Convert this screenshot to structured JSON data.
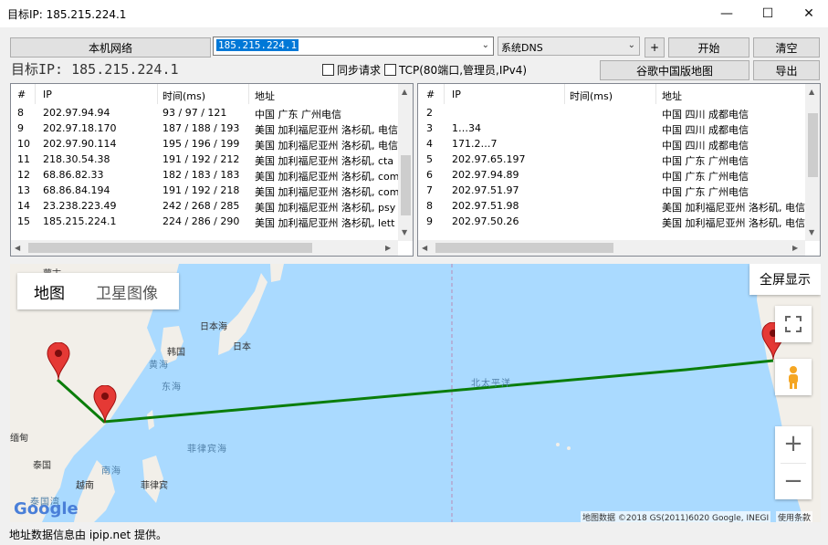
{
  "window": {
    "title": "目标IP: 185.215.224.1",
    "min": "—",
    "max": "☐",
    "close": "✕"
  },
  "toolbar": {
    "local_net": "本机网络",
    "ip_value": "185.215.224.1",
    "dns": "系统DNS",
    "plus": "+",
    "start": "开始",
    "clear": "清空",
    "google_map": "谷歌中国版地图",
    "export": "导出",
    "target_label": "目标IP: 185.215.224.1",
    "sync": "同步请求",
    "tcp": "TCP(80端口,管理员,IPv4)"
  },
  "left_list": {
    "headers": [
      "#",
      "IP",
      "时间(ms)",
      "地址"
    ],
    "rows": [
      {
        "n": "8",
        "ip": "202.97.94.94",
        "t": "93 / 97 / 121",
        "a": "中国 广东 广州电信"
      },
      {
        "n": "9",
        "ip": "202.97.18.170",
        "t": "187 / 188 / 193",
        "a": "美国 加利福尼亚州 洛杉矶, 电信"
      },
      {
        "n": "10",
        "ip": "202.97.90.114",
        "t": "195 / 196 / 199",
        "a": "美国 加利福尼亚州 洛杉矶, 电信"
      },
      {
        "n": "11",
        "ip": "218.30.54.38",
        "t": "191 / 192 / 212",
        "a": "美国 加利福尼亚州 洛杉矶, cta"
      },
      {
        "n": "12",
        "ip": "68.86.82.33",
        "t": "182 / 183 / 183",
        "a": "美国 加利福尼亚州 洛杉矶, com"
      },
      {
        "n": "13",
        "ip": "68.86.84.194",
        "t": "191 / 192 / 218",
        "a": "美国 加利福尼亚州 洛杉矶, com"
      },
      {
        "n": "14",
        "ip": "23.238.223.49",
        "t": "242 / 268 / 285",
        "a": "美国 加利福尼亚州 洛杉矶, psy"
      },
      {
        "n": "15",
        "ip": "185.215.224.1",
        "t": "224 / 286 / 290",
        "a": "美国 加利福尼亚州 洛杉矶, lett"
      }
    ]
  },
  "right_list": {
    "headers": [
      "#",
      "IP",
      "时间(ms)",
      "地址"
    ],
    "rows": [
      {
        "n": "2",
        "ip": "",
        "t": "",
        "a": "中国 四川 成都电信"
      },
      {
        "n": "3",
        "ip": "1…34",
        "t": "",
        "a": "中国 四川 成都电信"
      },
      {
        "n": "4",
        "ip": "171.2…7",
        "t": "",
        "a": "中国 四川 成都电信"
      },
      {
        "n": "5",
        "ip": "202.97.65.197",
        "t": "",
        "a": "中国 广东 广州电信"
      },
      {
        "n": "6",
        "ip": "202.97.94.89",
        "t": "",
        "a": "中国 广东 广州电信"
      },
      {
        "n": "7",
        "ip": "202.97.51.97",
        "t": "",
        "a": "中国 广东 广州电信"
      },
      {
        "n": "8",
        "ip": "202.97.51.98",
        "t": "",
        "a": "美国 加利福尼亚州 洛杉矶, 电信"
      },
      {
        "n": "9",
        "ip": "202.97.50.26",
        "t": "",
        "a": "美国 加利福尼亚州 洛杉矶, 电信"
      }
    ]
  },
  "map": {
    "tab_map": "地图",
    "tab_satellite": "卫星图像",
    "fullscreen": "全屏显示",
    "zoom_in": "+",
    "zoom_out": "−",
    "labels": {
      "japan_sea": "日本海",
      "japan": "日本",
      "korea": "韩国",
      "yellow_sea": "黄海",
      "east_sea": "东海",
      "pacific": "北太平洋",
      "philippine_sea": "菲律宾海",
      "south_sea": "南海",
      "myanmar": "缅甸",
      "thailand": "泰国",
      "vietnam": "越南",
      "philippines": "菲律宾",
      "thailand_gulf": "泰国湾",
      "mongolia": "蒙古"
    },
    "attribution": "地图数据 ©2018 GS(2011)6020 Google, INEGI",
    "terms": "使用条款",
    "google": "Google"
  },
  "status": "地址数据信息由 ipip.net 提供。",
  "colors": {
    "route": "#0a7d0a",
    "marker": "#e53935",
    "sea": "#aadaff",
    "land": "#f2efe9",
    "selection": "#0078d7"
  }
}
